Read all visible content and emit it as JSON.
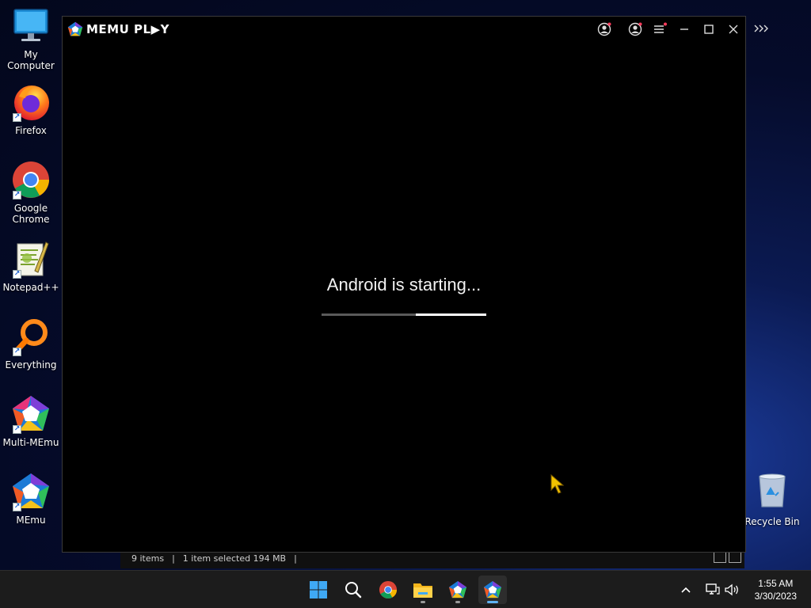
{
  "desktop": {
    "icons": [
      {
        "label": "My Computer"
      },
      {
        "label": "Firefox"
      },
      {
        "label": "Google Chrome"
      },
      {
        "label": "Notepad++"
      },
      {
        "label": "Everything"
      },
      {
        "label": "Multi-MEmu"
      },
      {
        "label": "MEmu"
      }
    ],
    "recycle_bin": {
      "label": "Recycle Bin"
    }
  },
  "explorer_status": {
    "items_count": "9 items",
    "selected": "1 item selected  194 MB"
  },
  "memu": {
    "logo_text": "MEMU PL▶Y",
    "title_buttons": [
      "account-icon",
      "account-icon",
      "menu-icon",
      "minimize-icon",
      "maximize-icon",
      "close-icon"
    ],
    "boot_message": "Android is starting...",
    "progress_fraction": 0.57
  },
  "taskbar": {
    "apps": [
      "windows-start-icon",
      "search-icon",
      "chrome-icon",
      "file-explorer-icon",
      "multi-memu-icon",
      "memu-icon"
    ],
    "clock_time": "1:55 AM",
    "clock_date": "3/30/2023"
  },
  "colors": {
    "accent_blue": "#5fb2f2",
    "memu_bg": "#000000",
    "taskbar_bg": "#1c1c1c"
  }
}
